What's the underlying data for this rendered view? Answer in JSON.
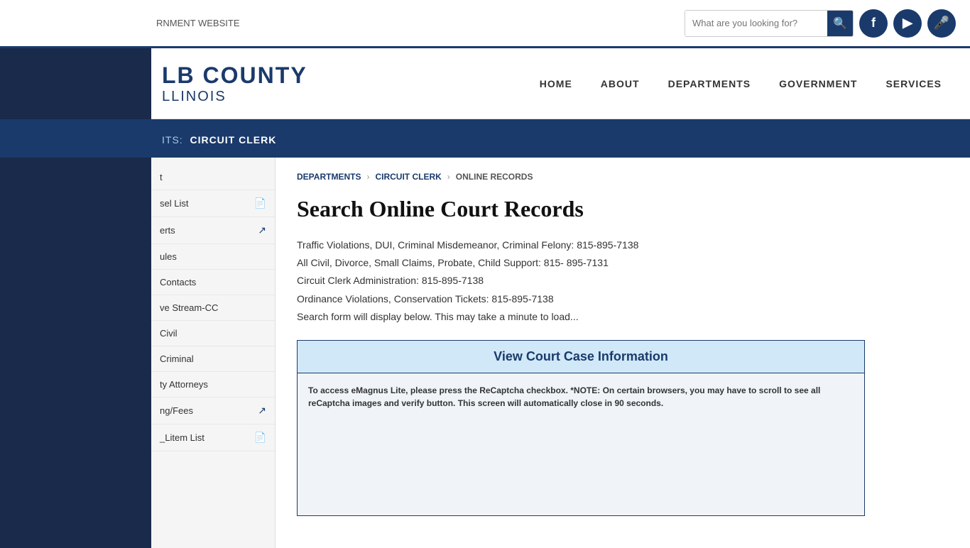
{
  "topbar": {
    "govt_label": "RNMENT WEBSITE"
  },
  "search": {
    "placeholder": "What are you looking for?"
  },
  "social": {
    "facebook": "f",
    "youtube": "▶",
    "mic": "🎤"
  },
  "header": {
    "logo_line1": "LB COUNTY",
    "logo_line2": "LLINOIS"
  },
  "nav": {
    "items": [
      {
        "label": "HOME"
      },
      {
        "label": "ABOUT"
      },
      {
        "label": "DEPARTMENTS"
      },
      {
        "label": "GOVERNMENT"
      },
      {
        "label": "SERVICES"
      }
    ]
  },
  "dept_banner": {
    "prefix": "ITS:",
    "name": "CIRCUIT CLERK"
  },
  "breadcrumb": {
    "departments": "DEPARTMENTS",
    "circuit_clerk": "CIRCUIT CLERK",
    "current": "ONLINE RECORDS"
  },
  "page": {
    "title": "Search Online Court Records",
    "info_lines": [
      "Traffic Violations, DUI, Criminal Misdemeanor, Criminal Felony: 815-895-7138",
      "All Civil, Divorce, Small Claims, Probate, Child Support: 815- 895-7131",
      "Circuit Clerk Administration: 815-895-7138",
      "Ordinance Violations, Conservation Tickets: 815-895-7138",
      "Search form will display below.  This may take a minute to load..."
    ]
  },
  "court_case_box": {
    "title": "View Court Case Information",
    "note": "To access eMagnus Lite, please press the ReCaptcha checkbox. *NOTE: On certain browsers, you may have to scroll to see all reCaptcha images and verify button. This screen will automatically close in 90 seconds."
  },
  "sidebar": {
    "items": [
      {
        "label": "t",
        "icon": "",
        "has_pdf": false
      },
      {
        "label": "sel List",
        "icon": "pdf",
        "has_icon": true
      },
      {
        "label": "erts",
        "icon": "external",
        "has_icon": true
      },
      {
        "label": "ules",
        "icon": "",
        "has_icon": false
      },
      {
        "label": "Contacts",
        "icon": "",
        "has_icon": false
      },
      {
        "label": "ve Stream-CC",
        "icon": "",
        "has_icon": false
      },
      {
        "label": "Civil",
        "icon": "",
        "has_icon": false
      },
      {
        "label": "Criminal",
        "icon": "",
        "has_icon": false
      },
      {
        "label": "ty Attorneys",
        "icon": "",
        "has_icon": false
      },
      {
        "label": "ng/Fees",
        "icon": "external",
        "has_icon": true
      },
      {
        "label": "_Litem List",
        "icon": "pdf",
        "has_icon": true
      }
    ]
  }
}
